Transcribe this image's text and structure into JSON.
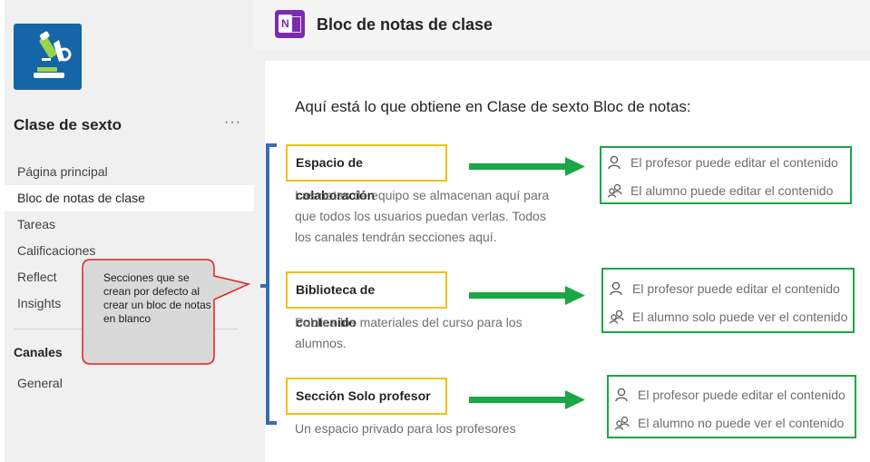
{
  "sidebar": {
    "team_name": "Clase de sexto",
    "more": "···",
    "nav": [
      {
        "label": "Página principal"
      },
      {
        "label": "Bloc de notas de clase"
      },
      {
        "label": "Tareas"
      },
      {
        "label": "Calificaciones"
      },
      {
        "label": "Reflect"
      },
      {
        "label": "Insights"
      }
    ],
    "channels_heading": "Canales",
    "channels": [
      "General"
    ]
  },
  "header": {
    "title": "Bloc de notas de clase",
    "app_icon": "onenote-icon"
  },
  "content": {
    "title": "Aquí está lo que obtiene en Clase de sexto Bloc de notas:",
    "sections": [
      {
        "label": "Espacio de colaboración",
        "description": [
          "Las notas de equipo se almacenan aquí para",
          "que todos los usuarios puedan verlas. Todos",
          "los canales tendrán secciones aquí."
        ],
        "teacher": "El profesor puede editar el contenido",
        "student": "El alumno puede editar el contenido"
      },
      {
        "label": "Biblioteca de contenido",
        "description": [
          "Publica los materiales del curso para los",
          "alumnos."
        ],
        "teacher": "El profesor puede editar el contenido",
        "student": "El alumno solo puede ver el contenido"
      },
      {
        "label": "Sección Solo profesor",
        "description": [
          "Un espacio privado para los profesores"
        ],
        "teacher": "El profesor puede editar el contenido",
        "student": "El alumno no puede ver el contenido"
      }
    ]
  },
  "callout": {
    "text": "Secciones que se crean por defecto al crear un bloc de notas en blanco"
  },
  "colors": {
    "label_border": "#f2c012",
    "perm_border": "#1aa745",
    "arrow": "#1aa745",
    "bracket": "#3a6bb5",
    "callout_border": "#e02020",
    "callout_fill": "#d9d9d9",
    "onenote": "#7b2bb0",
    "app_tile": "#1565a8"
  }
}
